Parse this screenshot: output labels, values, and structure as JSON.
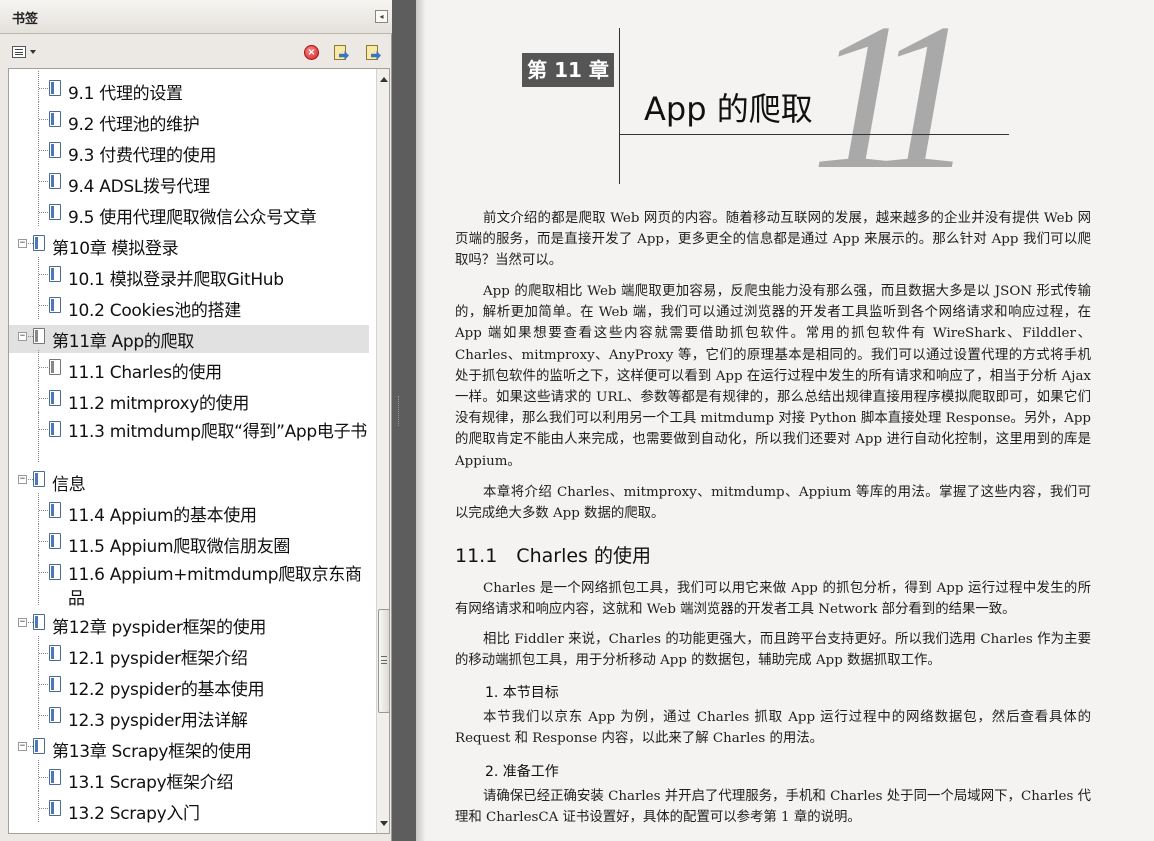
{
  "sidebar": {
    "title": "书签",
    "collapse_glyph": "◂",
    "toolbar": {
      "options_icon": "bookmark-options-icon",
      "delete_icon": "delete-bookmark-icon",
      "delete_glyph": "×",
      "new_icon": "new-bookmark-icon",
      "expand_icon": "expand-bookmark-icon"
    },
    "items": [
      {
        "label": "9.1 代理的设置",
        "level": 2
      },
      {
        "label": "9.2 代理池的维护",
        "level": 2
      },
      {
        "label": "9.3 付费代理的使用",
        "level": 2
      },
      {
        "label": "9.4 ADSL拨号代理",
        "level": 2
      },
      {
        "label": "9.5 使用代理爬取微信公众号文章",
        "level": 2
      },
      {
        "label": "第10章 模拟登录",
        "level": 1,
        "expanded": true
      },
      {
        "label": "10.1 模拟登录并爬取GitHub",
        "level": 2
      },
      {
        "label": "10.2 Cookies池的搭建",
        "level": 2
      },
      {
        "label": "第11章 App的爬取",
        "level": 1,
        "expanded": true,
        "selected": true
      },
      {
        "label": "11.1 Charles的使用",
        "level": 2
      },
      {
        "label": "11.2 mitmproxy的使用",
        "level": 2
      },
      {
        "label": "11.3 mitmdump爬取“得到”App电子书",
        "level": 2
      },
      {
        "label": "信息",
        "level": 1,
        "expanded": true
      },
      {
        "label": "11.4 Appium的基本使用",
        "level": 2
      },
      {
        "label": "11.5 Appium爬取微信朋友圈",
        "level": 2
      },
      {
        "label": "11.6 Appium+mitmdump爬取京东商品",
        "level": 2
      },
      {
        "label": "第12章 pyspider框架的使用",
        "level": 1,
        "expanded": true
      },
      {
        "label": "12.1 pyspider框架介绍",
        "level": 2
      },
      {
        "label": "12.2 pyspider的基本使用",
        "level": 2
      },
      {
        "label": "12.3 pyspider用法详解",
        "level": 2
      },
      {
        "label": "第13章 Scrapy框架的使用",
        "level": 1,
        "expanded": true
      },
      {
        "label": "13.1 Scrapy框架介绍",
        "level": 2
      },
      {
        "label": "13.2 Scrapy入门",
        "level": 2
      }
    ],
    "collapse_symbol": "−"
  },
  "document": {
    "chapter_badge": "第 11 章",
    "chapter_title": "App 的爬取",
    "chapter_number": "11",
    "paragraphs": [
      "前文介绍的都是爬取 Web 网页的内容。随着移动互联网的发展，越来越多的企业并没有提供 Web 网页端的服务，而是直接开发了 App，更多更全的信息都是通过 App 来展示的。那么针对 App 我们可以爬取吗？当然可以。",
      "App 的爬取相比 Web 端爬取更加容易，反爬虫能力没有那么强，而且数据大多是以 JSON 形式传输的，解析更加简单。在 Web 端，我们可以通过浏览器的开发者工具监听到各个网络请求和响应过程，在 App 端如果想要查看这些内容就需要借助抓包软件。常用的抓包软件有 WireShark、Filddler、Charles、mitmproxy、AnyProxy 等，它们的原理基本是相同的。我们可以通过设置代理的方式将手机处于抓包软件的监听之下，这样便可以看到 App 在运行过程中发生的所有请求和响应了，相当于分析 Ajax 一样。如果这些请求的 URL、参数等都是有规律的，那么总结出规律直接用程序模拟爬取即可，如果它们没有规律，那么我们可以利用另一个工具 mitmdump 对接 Python 脚本直接处理 Response。另外，App 的爬取肯定不能由人来完成，也需要做到自动化，所以我们还要对 App 进行自动化控制，这里用到的库是 Appium。",
      "本章将介绍 Charles、mitmproxy、mitmdump、Appium 等库的用法。掌握了这些内容，我们可以完成绝大多数 App 数据的爬取。"
    ],
    "section_title": "11.1　Charles 的使用",
    "section_paragraphs": [
      "Charles 是一个网络抓包工具，我们可以用它来做 App 的抓包分析，得到 App 运行过程中发生的所有网络请求和响应内容，这就和 Web 端浏览器的开发者工具 Network 部分看到的结果一致。",
      "相比 Fiddler 来说，Charles 的功能更强大，而且跨平台支持更好。所以我们选用 Charles 作为主要的移动端抓包工具，用于分析移动 App 的数据包，辅助完成 App 数据抓取工作。"
    ],
    "sub1_title": "1. 本节目标",
    "sub1_text": "本节我们以京东 App 为例，通过 Charles 抓取 App 运行过程中的网络数据包，然后查看具体的 Request 和 Response 内容，以此来了解 Charles 的用法。",
    "sub2_title": "2. 准备工作",
    "sub2_text": "请确保已经正确安装 Charles 并开启了代理服务，手机和 Charles 处于同一个局域网下，Charles 代理和 CharlesCA 证书设置好，具体的配置可以参考第 1 章的说明。"
  }
}
